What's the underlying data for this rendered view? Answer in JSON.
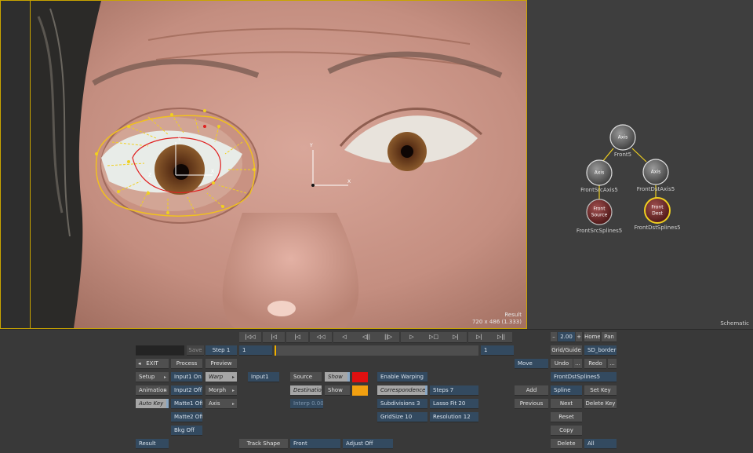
{
  "viewer": {
    "result_label": "Result",
    "resolution": "720 x 486 (1.333)"
  },
  "schematic": {
    "title": "Schematic",
    "nodes": [
      {
        "id": "axis-top",
        "text": "Axis",
        "label": "Front5"
      },
      {
        "id": "axis-left",
        "text": "Axis",
        "label": "FrontSrcAxis5"
      },
      {
        "id": "axis-right",
        "text": "Axis",
        "label": "FrontDstAxis5"
      },
      {
        "id": "front-source",
        "text1": "Front",
        "text2": "Source",
        "label": "FrontSrcSplines5"
      },
      {
        "id": "front-dest",
        "text1": "Front",
        "text2": "Dest",
        "label": "FrontDstSplines5"
      }
    ]
  },
  "transport": {
    "glyphs": [
      "|◁◁",
      "|◁",
      "|◁",
      "◁◁",
      "◁",
      "◁||",
      "||▷",
      "▷",
      "▷□",
      "▷|",
      "▷|",
      "▷||"
    ]
  },
  "timeline": {
    "start": "1",
    "end": "1"
  },
  "left_panel": {
    "save": "Save",
    "step": "Step 1",
    "exit": "EXIT",
    "process": "Process",
    "preview": "Preview",
    "setup": "Setup",
    "animation": "Animation",
    "auto_key": "Auto Key",
    "result": "Result",
    "input1_on": "Input1 On",
    "input2_off": "Input2 Off",
    "matte1_off": "Matte1 Off",
    "matte2_off": "Matte2 Off",
    "bkg_off": "Bkg Off",
    "warp": "Warp",
    "morph": "Morph",
    "axis": "Axis"
  },
  "middle_panel": {
    "input1": "Input1",
    "source": "Source",
    "destination": "Destination",
    "show1": "Show",
    "show2": "Show",
    "interp": "Interp 0.00",
    "track_shape": "Track Shape",
    "front": "Front",
    "adjust_off": "Adjust Off",
    "enable_warping": "Enable Warping",
    "correspondences": "Correspondences",
    "steps": "Steps 7",
    "subdivisions": "Subdivisions 3",
    "lasso_fit": "Lasso Fit 20",
    "grid_size": "GridSize 10",
    "resolution": "Resolution 12",
    "source_color": "#e01010",
    "dest_color": "#f2a010"
  },
  "right_panel": {
    "minus": "–",
    "zoom": "2.00",
    "plus": "+",
    "home": "Home",
    "pan": "Pan",
    "grid_guide": "Grid/Guide",
    "sd_border": "SD_border",
    "move": "Move",
    "undo": "Undo",
    "undo_more": "...",
    "redo": "Redo",
    "redo_more": "...",
    "spline_name": "FrontDstSplines5",
    "add": "Add",
    "spline": "Spline",
    "set_key": "Set Key",
    "previous": "Previous",
    "next": "Next",
    "delete_key": "Delete Key",
    "reset": "Reset",
    "copy": "Copy",
    "delete": "Delete",
    "all": "All"
  }
}
